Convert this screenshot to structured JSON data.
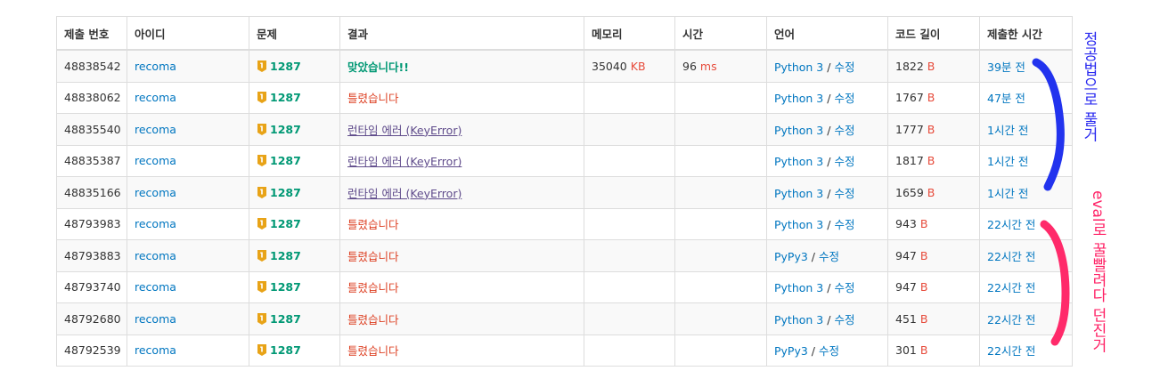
{
  "columns": [
    "제출 번호",
    "아이디",
    "문제",
    "결과",
    "메모리",
    "시간",
    "언어",
    "코드 길이",
    "제출한 시간"
  ],
  "units": {
    "memory": "KB",
    "time": "ms",
    "length": "B"
  },
  "edit_label": "수정",
  "lang_sep": " / ",
  "rows": [
    {
      "id": "48838542",
      "user": "recoma",
      "problem": "1287",
      "result": "맞았습니다!!",
      "result_type": "ac",
      "memory": "35040",
      "time": "96",
      "lang": "Python 3",
      "length": "1822",
      "submitted": "39분 전"
    },
    {
      "id": "48838062",
      "user": "recoma",
      "problem": "1287",
      "result": "틀렸습니다",
      "result_type": "wa",
      "memory": "",
      "time": "",
      "lang": "Python 3",
      "length": "1767",
      "submitted": "47분 전"
    },
    {
      "id": "48835540",
      "user": "recoma",
      "problem": "1287",
      "result": "런타임 에러 (KeyError)",
      "result_type": "re",
      "memory": "",
      "time": "",
      "lang": "Python 3",
      "length": "1777",
      "submitted": "1시간 전"
    },
    {
      "id": "48835387",
      "user": "recoma",
      "problem": "1287",
      "result": "런타임 에러 (KeyError)",
      "result_type": "re",
      "memory": "",
      "time": "",
      "lang": "Python 3",
      "length": "1817",
      "submitted": "1시간 전"
    },
    {
      "id": "48835166",
      "user": "recoma",
      "problem": "1287",
      "result": "런타임 에러 (KeyError)",
      "result_type": "re",
      "memory": "",
      "time": "",
      "lang": "Python 3",
      "length": "1659",
      "submitted": "1시간 전"
    },
    {
      "id": "48793983",
      "user": "recoma",
      "problem": "1287",
      "result": "틀렸습니다",
      "result_type": "wa",
      "memory": "",
      "time": "",
      "lang": "Python 3",
      "length": "943",
      "submitted": "22시간 전"
    },
    {
      "id": "48793883",
      "user": "recoma",
      "problem": "1287",
      "result": "틀렸습니다",
      "result_type": "wa",
      "memory": "",
      "time": "",
      "lang": "PyPy3",
      "length": "947",
      "submitted": "22시간 전"
    },
    {
      "id": "48793740",
      "user": "recoma",
      "problem": "1287",
      "result": "틀렸습니다",
      "result_type": "wa",
      "memory": "",
      "time": "",
      "lang": "Python 3",
      "length": "947",
      "submitted": "22시간 전"
    },
    {
      "id": "48792680",
      "user": "recoma",
      "problem": "1287",
      "result": "틀렸습니다",
      "result_type": "wa",
      "memory": "",
      "time": "",
      "lang": "Python 3",
      "length": "451",
      "submitted": "22시간 전"
    },
    {
      "id": "48792539",
      "user": "recoma",
      "problem": "1287",
      "result": "틀렸습니다",
      "result_type": "wa",
      "memory": "",
      "time": "",
      "lang": "PyPy3",
      "length": "301",
      "submitted": "22시간 전"
    }
  ],
  "annotations": {
    "blue_text": "정공법으로 풀거",
    "red_text": "eval로 꿀빨려다 던진거",
    "blue_color": "#2a2af0",
    "red_color": "#ff2266"
  },
  "colors": {
    "link": "#0076c0",
    "accepted": "#009874",
    "wrong": "#dd4124",
    "runtime_error": "#5f4b8b",
    "unit": "#e74c3c",
    "tier_badge": "#e8a317"
  },
  "icons": {
    "problem_tier": "bronze-tier-icon"
  }
}
